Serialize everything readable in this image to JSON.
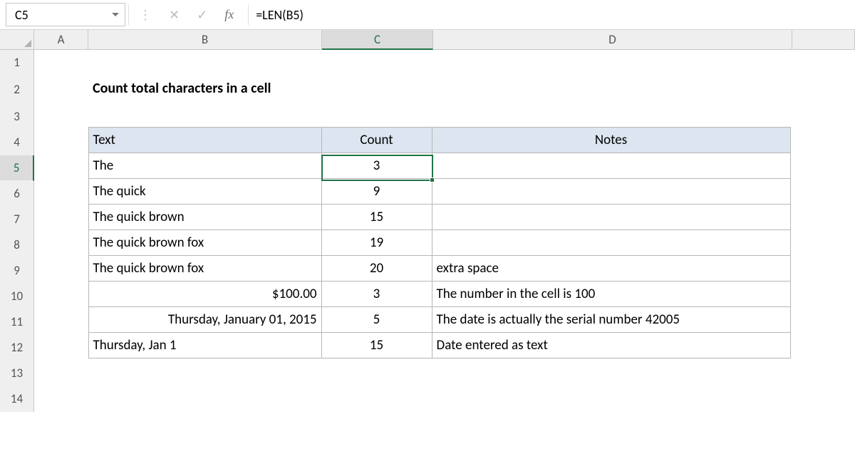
{
  "formula_bar": {
    "name_box": "C5",
    "formula": "=LEN(B5)"
  },
  "columns": [
    "A",
    "B",
    "C",
    "D"
  ],
  "row_numbers": [
    "1",
    "2",
    "3",
    "4",
    "5",
    "6",
    "7",
    "8",
    "9",
    "10",
    "11",
    "12",
    "13",
    "14"
  ],
  "title": "Count total characters in a cell",
  "table": {
    "headers": {
      "b": "Text",
      "c": "Count",
      "d": "Notes"
    },
    "rows": [
      {
        "text": "The",
        "count": "3",
        "notes": ""
      },
      {
        "text": "The quick",
        "count": "9",
        "notes": ""
      },
      {
        "text": "The quick brown",
        "count": "15",
        "notes": ""
      },
      {
        "text": "The quick brown fox",
        "count": "19",
        "notes": ""
      },
      {
        "text": "The quick brown  fox",
        "count": "20",
        "notes": "extra space"
      },
      {
        "text": "$100.00",
        "count": "3",
        "notes": "The number in the cell is 100",
        "align": "right"
      },
      {
        "text": "Thursday, January 01, 2015",
        "count": "5",
        "notes": "The date is actually the serial number 42005",
        "align": "right"
      },
      {
        "text": "Thursday, Jan 1",
        "count": "15",
        "notes": "Date entered as text"
      }
    ]
  },
  "active": {
    "col": "C",
    "row": "5"
  },
  "icons": {
    "cancel": "✕",
    "enter": "✓",
    "fx": "fx",
    "sep": "⋮"
  }
}
